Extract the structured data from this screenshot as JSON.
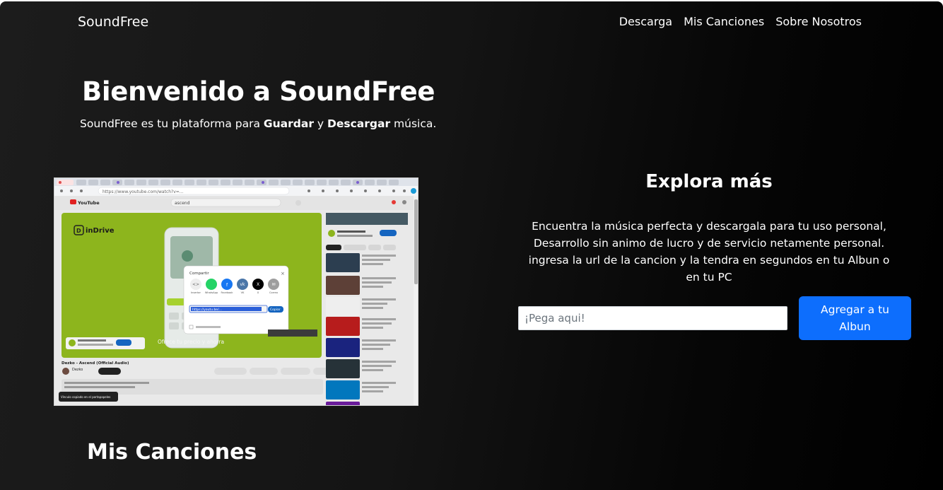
{
  "nav": {
    "brand": "SoundFree",
    "links": [
      "Descarga",
      "Mis Canciones",
      "Sobre Nosotros"
    ]
  },
  "hero": {
    "title": "Bienvenido a SoundFree",
    "sub_prefix": "SoundFree es tu plataforma para ",
    "sub_bold1": "Guardar",
    "sub_mid": " y ",
    "sub_bold2": "Descargar",
    "sub_suffix": " música."
  },
  "screenshot": {
    "search_text": "ascend",
    "ad_brand": "inDrive",
    "ad_tagline": "Ofrece tu precio y ahorra",
    "share_title": "Compartir",
    "share_targets": [
      "Insertar",
      "WhatsApp",
      "Facebook",
      "VK",
      "X",
      "Correo"
    ],
    "share_url": "https://youtu.be/...",
    "copy_label": "Copiar",
    "video_title": "Dezko - Ascend (Official Audio)",
    "channel": "Dezko",
    "toast": "Vínculo copiado en el portapapeles"
  },
  "explora": {
    "title": "Explora más",
    "text": "Encuentra la música perfecta y descargala para tu uso personal, Desarrollo sin animo de lucro y de servicio netamente personal. ingresa la url de la cancion y la tendra en segundos en tu Albun o en tu PC"
  },
  "form": {
    "placeholder": "¡Pega aqui!",
    "button": "Agregar a tu Albun"
  },
  "songs": {
    "title": "Mis Canciones"
  },
  "colors": {
    "accent": "#0d6efd",
    "ad_green": "#8db51d"
  }
}
